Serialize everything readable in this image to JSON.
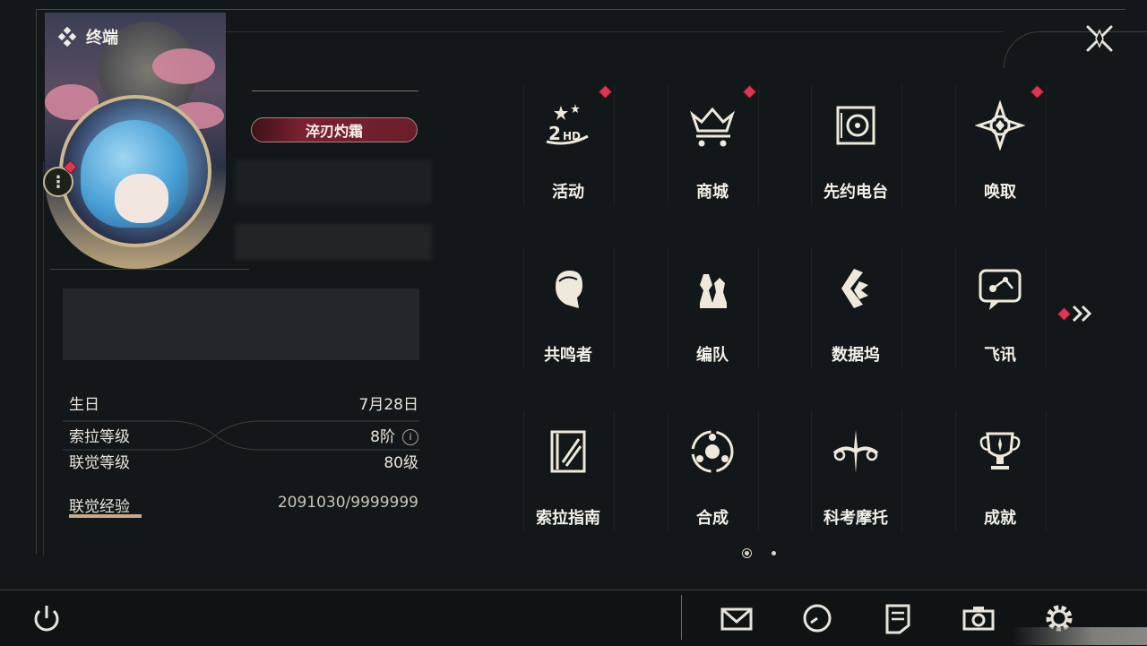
{
  "header": {
    "title": "终端",
    "close_label": "close"
  },
  "profile": {
    "name_badge": "淬刃灼霜",
    "fields": [
      {
        "label": "生日",
        "value": "7月28日"
      },
      {
        "label": "索拉等级",
        "value": "8阶"
      },
      {
        "label": "联觉等级",
        "value": "80级"
      },
      {
        "label": "联觉经验",
        "value": "2091030/9999999"
      }
    ],
    "info_icon": "i"
  },
  "menu": {
    "tiles": [
      {
        "label": "活动",
        "icon": "event-2hd-icon",
        "badge": true
      },
      {
        "label": "商城",
        "icon": "crown-cart-icon",
        "badge": true
      },
      {
        "label": "先约电台",
        "icon": "radio-icon",
        "badge": false
      },
      {
        "label": "唤取",
        "icon": "compass-star-icon",
        "badge": true
      },
      {
        "label": "共鸣者",
        "icon": "resonator-head-icon",
        "badge": false
      },
      {
        "label": "编队",
        "icon": "chess-pieces-icon",
        "badge": false
      },
      {
        "label": "数据坞",
        "icon": "data-dock-icon",
        "badge": false
      },
      {
        "label": "飞讯",
        "icon": "chat-bubble-icon",
        "badge": false
      },
      {
        "label": "索拉指南",
        "icon": "guide-book-icon",
        "badge": false
      },
      {
        "label": "合成",
        "icon": "synthesis-icon",
        "badge": false
      },
      {
        "label": "科考摩托",
        "icon": "motorbike-icon",
        "badge": false
      },
      {
        "label": "成就",
        "icon": "trophy-icon",
        "badge": false
      }
    ],
    "pages": 2,
    "current_page": 1
  },
  "bottom": {
    "icons": [
      "power-icon",
      "mail-icon",
      "clock-icon",
      "notes-icon",
      "camera-icon",
      "settings-icon"
    ]
  },
  "colors": {
    "background": "#121719",
    "accent_gold": "#c8a98a",
    "badge_red": "#e0364f",
    "name_badge": "#7a2230"
  }
}
